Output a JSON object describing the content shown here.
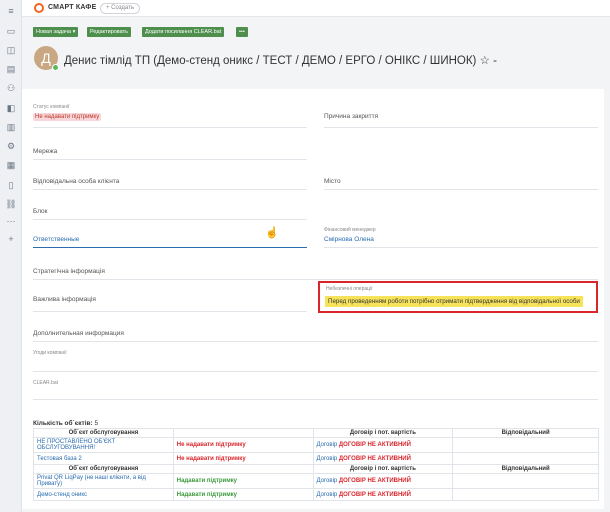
{
  "sidebar": {
    "icons": [
      "menu-icon",
      "book-icon",
      "box-icon",
      "clipboard-icon",
      "users-icon",
      "folder-icon",
      "chart-icon",
      "gear-icon",
      "calendar-icon",
      "document-icon",
      "link-icon",
      "more-icon",
      "plus-icon"
    ],
    "glyphs": [
      "≡",
      "▭",
      "◫",
      "▤",
      "⚇",
      "◧",
      "▥",
      "⚙",
      "▦",
      "▯",
      "⛓",
      "⋯",
      "+"
    ]
  },
  "topbar": {
    "logo_text": "СМАРТ КАФЕ",
    "create_label": "+ Создать"
  },
  "actions": {
    "new_task": "Новая задача ▾",
    "edit": "Редактировать",
    "add_clear": "Додати посилання CLEAR.bat",
    "more": "•••"
  },
  "header": {
    "avatar_letter": "Д",
    "title": "Денис тімлід ТП (Демо-стенд оникс / ТЕСТ / ДЕМО / ЕРГО / ОНІКС / ШИНОК) ☆ -"
  },
  "fields": {
    "status_label": "Статус компанії",
    "status_value": "Не надавати підтримку",
    "close_reason": "Причина закриття",
    "network": "Мережа",
    "responsible_client": "Відповідальна особа клієнта",
    "city": "Місто",
    "block": "Блок",
    "responsible": "Ответственные",
    "fin_manager_label": "Фінансовий менеджер",
    "fin_manager_value": "Смірнова Олена",
    "strategic_info": "Стратегічна інформація",
    "important_info": "Важлива інформація",
    "ops_label": "Небезпечні операції",
    "ops_value": "Перед проведенням роботи потрібно отримати підтвердження від відповідальної особи",
    "additional_info": "Дополнительная информация",
    "company_agreements": "Угоди компанії",
    "clear_bat": "CLEAR.bat"
  },
  "objects": {
    "count_label": "Кількість об`єктів:",
    "count_value": "5",
    "headers": [
      "Об`єкт обслуговування",
      "",
      "Договір і пот. вартість",
      "Відповідальний"
    ],
    "rows": [
      {
        "name": "НЕ ПРОСТАВЛЕНО ОБ'ЄКТ ОБСЛУГОВУВАННЯ!",
        "support": "Не надавати підтримку",
        "support_type": "red",
        "contract_prefix": "Договір",
        "contract_status": "ДОГОВІР НЕ АКТИВНИЙ",
        "responsible": ""
      },
      {
        "name": "Тестовая база 2",
        "support": "Не надавати підтримку",
        "support_type": "red",
        "contract_prefix": "Договір",
        "contract_status": "ДОГОВІР НЕ АКТИВНИЙ",
        "responsible": ""
      }
    ],
    "headers2": [
      "Об`єкт обслуговування",
      "",
      "Договір і пот. вартість",
      "Відповідальний"
    ],
    "rows2": [
      {
        "name": "Privat QR LiqPay (не наші клієнти, а від Привату)",
        "support": "Надавати підтримку",
        "support_type": "green",
        "contract_prefix": "Договір",
        "contract_status": "ДОГОВІР НЕ АКТИВНИЙ",
        "responsible": ""
      },
      {
        "name": "Демо-стенд оникс",
        "support": "Надавати підтримку",
        "support_type": "green",
        "contract_prefix": "Договір",
        "contract_status": "ДОГОВІР НЕ АКТИВНИЙ",
        "responsible": ""
      }
    ]
  }
}
